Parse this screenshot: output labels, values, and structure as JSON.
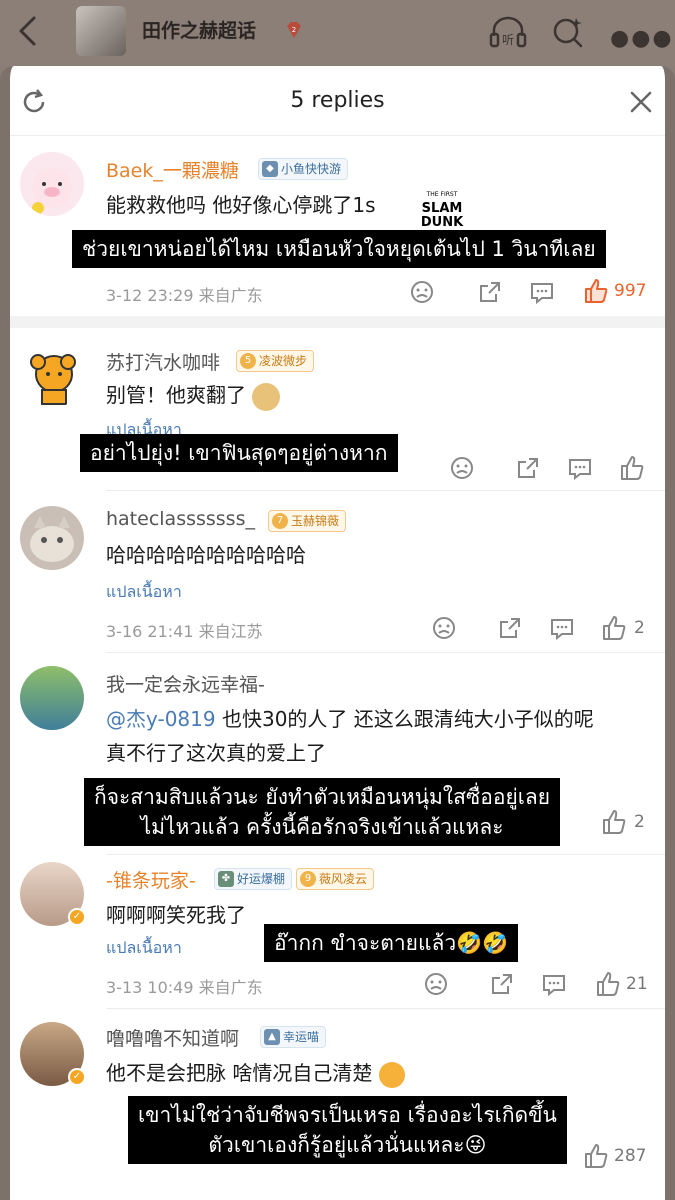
{
  "topbar": {
    "group_name": "田作之赫超话",
    "listen_label": "听"
  },
  "sheet": {
    "title": "5 replies"
  },
  "logo": {
    "line1": "THE FIRST",
    "line2": "SLAM",
    "line3": "DUNK"
  },
  "colors": {
    "accent_orange": "#e8832d",
    "link_blue": "#4a7bb5",
    "like_hot": "#e8632d"
  },
  "comments": [
    {
      "username": "Baek_一顆濃糖",
      "tag": "小鱼快快游",
      "text": "能救救他吗 他好像心停跳了1s",
      "subtitle": "ช่วยเขาหน่อยได้ไหม เหมือนหัวใจหยุดเต้นไป 1 วินาทีเลย",
      "date": "3-12 23:29",
      "location": "来自广东",
      "likes": "997"
    },
    {
      "username": "苏打汽水咖啡",
      "level": "5",
      "tag": "凌波微步",
      "text": "别管！他爽翻了",
      "translate": "แปลเนื้อหา",
      "subtitle": "อย่าไปยุ่ง! เขาฟินสุดๆอยู่ต่างหาก"
    },
    {
      "username": "hateclasssssss_",
      "level": "7",
      "tag": "玉赫锦薇",
      "text": "哈哈哈哈哈哈哈哈哈哈",
      "translate": "แปลเนื้อหา",
      "date": "3-16 21:41",
      "location": "来自江苏",
      "likes": "2"
    },
    {
      "username": "我一定会永远幸福-",
      "mention": "@杰y-0819",
      "text1": " 也快30的人了 还这么跟清纯大小子似的呢",
      "text2": "真不行了这次真的爱上了",
      "subtitle1": "ก็จะสามสิบแล้วนะ ยังทำตัวเหมือนหนุ่มใสซื่ออยู่เลย",
      "subtitle2": "ไม่ไหวแล้ว ครั้งนี้คือรักจริงเข้าแล้วแหละ",
      "likes": "2"
    },
    {
      "username": "-锥条玩家-",
      "tag": "好运爆棚",
      "level": "9",
      "tag2": "薇风凌云",
      "text": "啊啊啊笑死我了",
      "translate": "แปลเนื้อหา",
      "subtitle": "อ๊ากก ขำจะตายแล้ว🤣🤣",
      "date": "3-13 10:49",
      "location": "来自广东",
      "likes": "21"
    },
    {
      "username": "噜噜噜不知道啊",
      "tag": "幸运喵",
      "text": "他不是会把脉 啥情况自己清楚",
      "subtitle1": "เขาไม่ใช่ว่าจับชีพจรเป็นเหรอ เรื่องอะไรเกิดขึ้น",
      "subtitle2": "ตัวเขาเองก็รู้อยู่แล้วนั่นแหละ😜",
      "likes": "287"
    }
  ]
}
